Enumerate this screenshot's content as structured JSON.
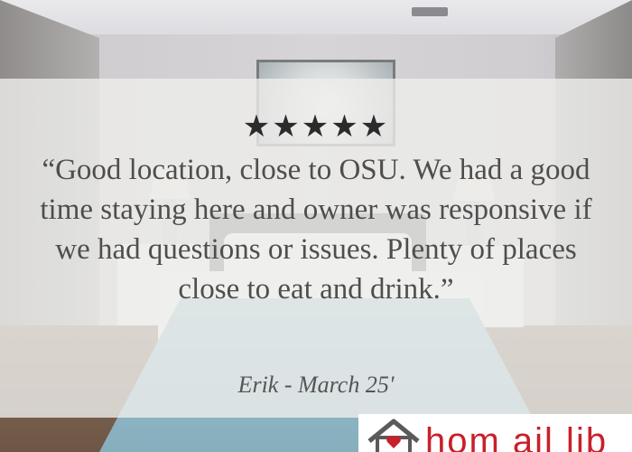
{
  "review": {
    "rating_stars": 5,
    "stars_text": "★★★★★",
    "quote": "“Good location, close to OSU. We had a good time staying here and owner was responsive if we had questions or issues. Plenty of places close to eat and drink.”",
    "author": "Erik - March 25'"
  },
  "logo": {
    "visible_text": "hom     ail lib",
    "brand_color": "#c8202a"
  },
  "colors": {
    "band": "#eeedeb",
    "stars": "#2b2b2b",
    "quote_text": "#4e4e4e"
  }
}
